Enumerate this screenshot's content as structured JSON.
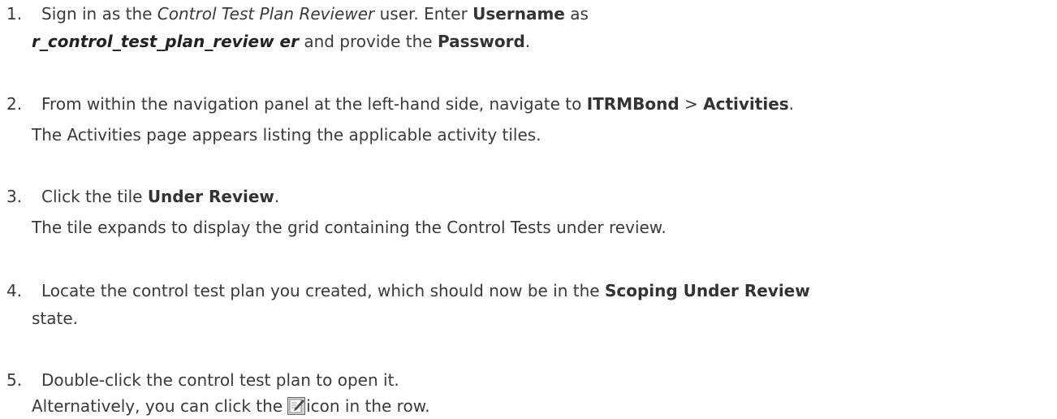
{
  "steps": [
    {
      "num": "1.",
      "l1_a": "Sign in as the ",
      "l1_b": "Control Test Plan Reviewer",
      "l1_c": " user. Enter ",
      "l1_d": "Username",
      "l1_e": " as",
      "l2_a": "r_control_test_plan_review er",
      "l2_b": " and provide the ",
      "l2_c": "Password",
      "l2_d": "."
    },
    {
      "num": "2.",
      "l1_a": "From within the navigation panel at the left-hand side, navigate to ",
      "l1_b": "ITRMBond",
      "l1_c": " > ",
      "l1_d": "Activities",
      "l1_e": ".",
      "l2": "The Activities page appears listing the applicable activity tiles."
    },
    {
      "num": "3.",
      "l1_a": "Click the tile ",
      "l1_b": "Under Review",
      "l1_c": ".",
      "l2": "The tile expands to display the grid containing the Control Tests under review."
    },
    {
      "num": "4.",
      "l1_a": "Locate the control test plan you created, which should now be in the ",
      "l1_b": "Scoping Under Review",
      "l2": "state."
    },
    {
      "num": "5.",
      "l1": "Double-click the control test plan to open it.",
      "l2_a": "Alternatively, you can click the",
      "l2_icon": "edit-icon",
      "l2_b": "icon in the row."
    }
  ]
}
